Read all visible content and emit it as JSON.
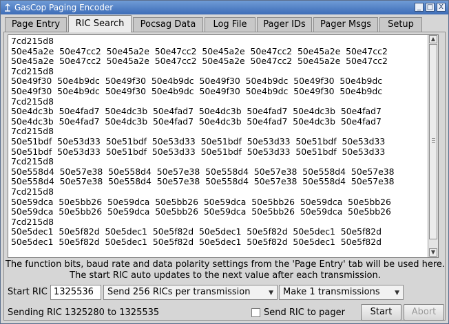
{
  "window": {
    "title": "GasCop Paging Encoder",
    "controls": [
      "_",
      "□",
      "X"
    ]
  },
  "tabs": [
    "Page Entry",
    "RIC Search",
    "Pocsag Data",
    "Log File",
    "Pager IDs",
    "Pager Msgs",
    "Setup"
  ],
  "active_tab": "RIC Search",
  "output_lines": [
    "7cd215d8",
    "50e45a2e  50e47cc2  50e45a2e  50e47cc2  50e45a2e  50e47cc2  50e45a2e  50e47cc2",
    "50e45a2e  50e47cc2  50e45a2e  50e47cc2  50e45a2e  50e47cc2  50e45a2e  50e47cc2",
    "7cd215d8",
    "50e49f30  50e4b9dc  50e49f30  50e4b9dc  50e49f30  50e4b9dc  50e49f30  50e4b9dc",
    "50e49f30  50e4b9dc  50e49f30  50e4b9dc  50e49f30  50e4b9dc  50e49f30  50e4b9dc",
    "7cd215d8",
    "50e4dc3b  50e4fad7  50e4dc3b  50e4fad7  50e4dc3b  50e4fad7  50e4dc3b  50e4fad7",
    "50e4dc3b  50e4fad7  50e4dc3b  50e4fad7  50e4dc3b  50e4fad7  50e4dc3b  50e4fad7",
    "7cd215d8",
    "50e51bdf  50e53d33  50e51bdf  50e53d33  50e51bdf  50e53d33  50e51bdf  50e53d33",
    "50e51bdf  50e53d33  50e51bdf  50e53d33  50e51bdf  50e53d33  50e51bdf  50e53d33",
    "7cd215d8",
    "50e558d4  50e57e38  50e558d4  50e57e38  50e558d4  50e57e38  50e558d4  50e57e38",
    "50e558d4  50e57e38  50e558d4  50e57e38  50e558d4  50e57e38  50e558d4  50e57e38",
    "7cd215d8",
    "50e59dca  50e5bb26  50e59dca  50e5bb26  50e59dca  50e5bb26  50e59dca  50e5bb26",
    "50e59dca  50e5bb26  50e59dca  50e5bb26  50e59dca  50e5bb26  50e59dca  50e5bb26",
    "7cd215d8",
    "50e5dec1  50e5f82d  50e5dec1  50e5f82d  50e5dec1  50e5f82d  50e5dec1  50e5f82d",
    "50e5dec1  50e5f82d  50e5dec1  50e5f82d  50e5dec1  50e5f82d  50e5dec1  50e5f82d"
  ],
  "info_line1": "The function bits, baud rate and data polarity settings from the 'Page Entry' tab will be used here.",
  "info_line2": "The start RIC auto updates to the next value after each transmission.",
  "start_ric_label": "Start RIC",
  "start_ric_value": "1325536",
  "rics_per_tx": "Send 256 RICs per transmission",
  "transmissions": "Make 1 transmissions",
  "status": "Sending RIC 1325280 to 1325535",
  "send_to_pager_label": "Send RIC to pager",
  "send_to_pager_checked": false,
  "start_button": "Start",
  "abort_button": "Abort"
}
